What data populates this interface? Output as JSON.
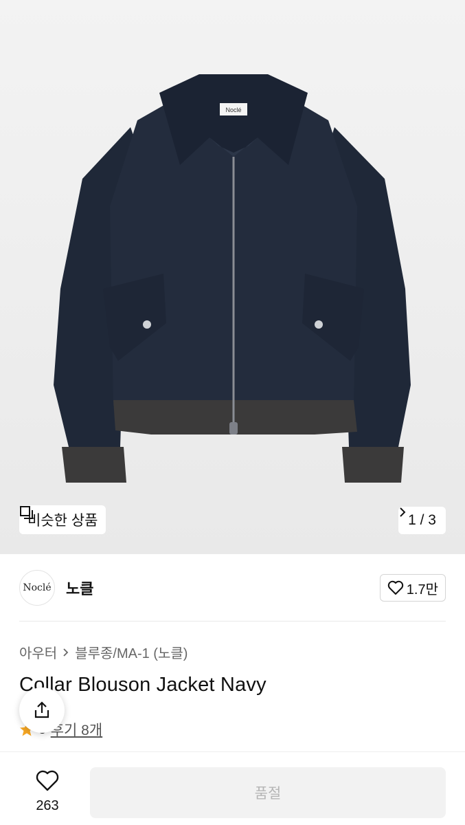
{
  "hero": {
    "similar_label": "비슷한 상품",
    "page_indicator": "1 / 3",
    "tag_label": "Noclé"
  },
  "brand": {
    "logo_text": "Noclé",
    "name": "노클",
    "like_count": "1.7만"
  },
  "breadcrumb": {
    "category": "아우터",
    "subcategory": "블루종/MA-1 (노클)"
  },
  "product": {
    "title": "Collar Blouson Jacket Navy",
    "rating": "5",
    "review_label": "후기 8개"
  },
  "bottom": {
    "wish_count": "263",
    "soldout_label": "품절"
  },
  "colors": {
    "jacket": "#232c3d",
    "rib": "#3b3a3a",
    "star": "#f5a623"
  },
  "icons": [
    "similar-items-icon",
    "chevron-right-icon",
    "chevron-right-icon",
    "heart-outline-icon",
    "share-icon",
    "star-icon",
    "heart-outline-icon"
  ]
}
